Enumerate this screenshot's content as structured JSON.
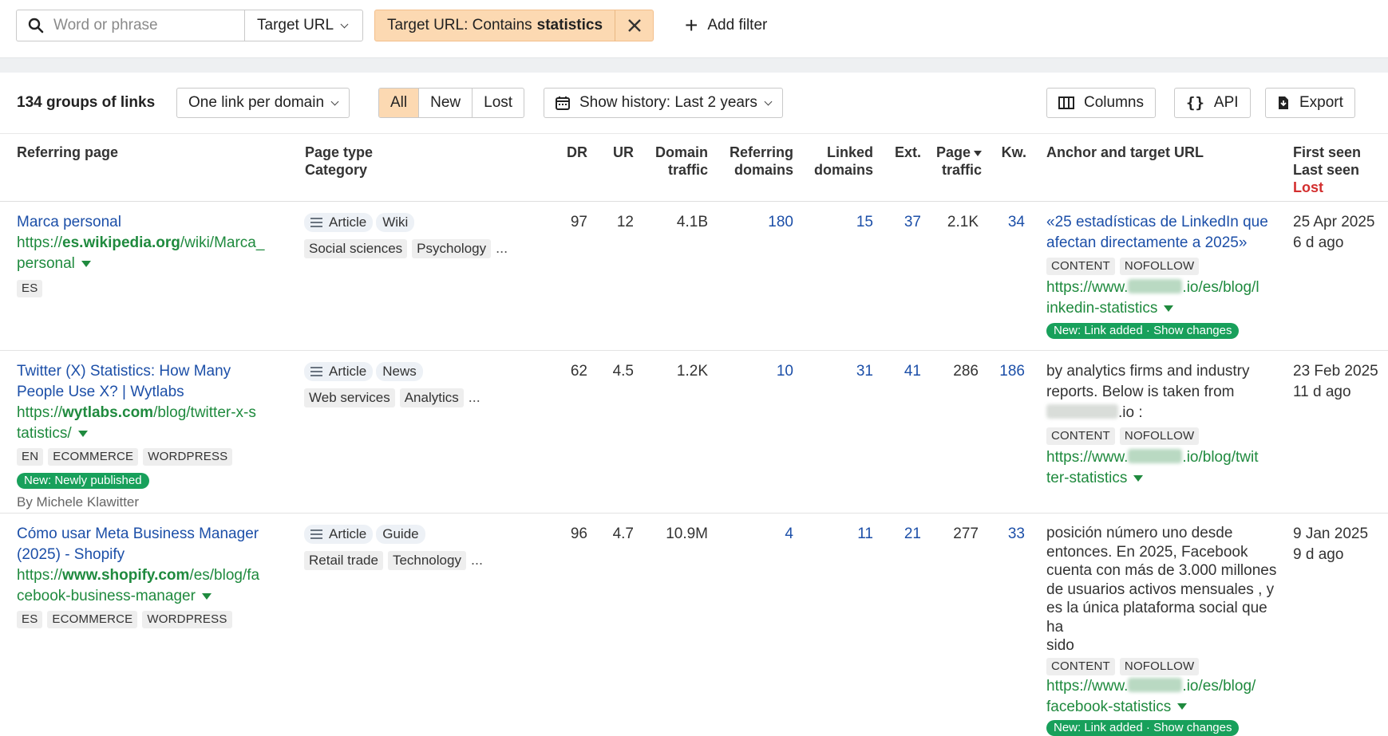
{
  "filters": {
    "search_placeholder": "Word or phrase",
    "target_select": "Target URL",
    "chip_prefix": "Target URL: Contains",
    "chip_value": "statistics",
    "add_filter": "Add filter"
  },
  "toolbar": {
    "count": "134 groups of links",
    "grouping": "One link per domain",
    "tabs": [
      "All",
      "New",
      "Lost"
    ],
    "active_tab": "All",
    "history": "Show history: Last 2 years",
    "columns": "Columns",
    "api": "API",
    "export": "Export"
  },
  "headers": {
    "referring_page": "Referring page",
    "page_type": "Page type",
    "category": "Category",
    "dr": "DR",
    "ur": "UR",
    "domain": "Domain",
    "traffic": "traffic",
    "referring": "Referring",
    "domains": "domains",
    "linked": "Linked",
    "linked_domains": "domains",
    "ext": "Ext.",
    "page": "Page",
    "page_traffic": "traffic",
    "kw": "Kw.",
    "anchor": "Anchor and target URL",
    "first_seen": "First seen",
    "last_seen": "Last seen",
    "lost": "Lost"
  },
  "rows": [
    {
      "title": "Marca personal",
      "url_pre": "https://",
      "url_bold": "es.wikipedia.org",
      "url_rest1": "/wiki/Marca_",
      "url_rest2": "personal",
      "lang": "ES",
      "type": "Article",
      "type2": "Wiki",
      "cat1": "Social sciences",
      "cat2": "Psychology",
      "more": "...",
      "dr": "97",
      "ur": "12",
      "domain_traffic": "4.1B",
      "ref_domains": "180",
      "linked_domains": "15",
      "ext": "37",
      "page_traffic": "2.1K",
      "kw": "34",
      "anchor1": "«25 estadísticas de LinkedIn que",
      "anchor2": "afectan directamente a 2025»",
      "tag1": "CONTENT",
      "tag2": "NOFOLLOW",
      "target1": "https://www.",
      "target1b": ".io/es/blog/l",
      "target2": "inkedin-statistics",
      "badge": "New: Link added · Show changes",
      "first_seen": "25 Apr 2025",
      "last_seen": "6 d ago"
    },
    {
      "title1": "Twitter (X) Statistics: How Many",
      "title2": "People Use X? | Wytlabs",
      "url_pre": "https://",
      "url_bold": "wytlabs.com",
      "url_rest1": "/blog/twitter-x-s",
      "url_rest2": "tatistics/",
      "lang": "EN",
      "tag_b": "ECOMMERCE",
      "tag_c": "WORDPRESS",
      "new_badge": "New: Newly published",
      "author": "By Michele Klawitter",
      "type": "Article",
      "type2": "News",
      "cat1": "Web services",
      "cat2": "Analytics",
      "more": "...",
      "dr": "62",
      "ur": "4.5",
      "domain_traffic": "1.2K",
      "ref_domains": "10",
      "linked_domains": "31",
      "ext": "41",
      "page_traffic": "286",
      "kw": "186",
      "anchor1": "by analytics firms and industry",
      "anchor2": "reports. Below is taken from",
      "anchor3": ".io :",
      "tag1": "CONTENT",
      "tag2": "NOFOLLOW",
      "target1": "https://www.",
      "target1b": ".io/blog/twit",
      "target2": "ter-statistics",
      "first_seen": "23 Feb 2025",
      "last_seen": "11 d ago"
    },
    {
      "title1": "Cómo usar Meta Business Manager",
      "title2": "(2025) - Shopify",
      "url_pre": "https://",
      "url_bold": "www.shopify.com",
      "url_rest1": "/es/blog/fa",
      "url_rest2": "cebook-business-manager",
      "lang": "ES",
      "tag_b": "ECOMMERCE",
      "tag_c": "WORDPRESS",
      "type": "Article",
      "type2": "Guide",
      "cat1": "Retail trade",
      "cat2": "Technology",
      "more": "...",
      "dr": "96",
      "ur": "4.7",
      "domain_traffic": "10.9M",
      "ref_domains": "4",
      "linked_domains": "11",
      "ext": "21",
      "page_traffic": "277",
      "kw": "33",
      "anchor1": "posición número uno desde",
      "anchor2": "entonces. En 2025, Facebook",
      "anchor3": "cuenta con más de 3.000 millones",
      "anchor4": "de usuarios activos mensuales , y",
      "anchor5": "es la única plataforma social que ha",
      "anchor6": "sido",
      "tag1": "CONTENT",
      "tag2": "NOFOLLOW",
      "target1": "https://www.",
      "target1b": ".io/es/blog/",
      "target2": "facebook-statistics",
      "badge": "New: Link added · Show changes",
      "first_seen": "9 Jan 2025",
      "last_seen": "9 d ago"
    }
  ]
}
